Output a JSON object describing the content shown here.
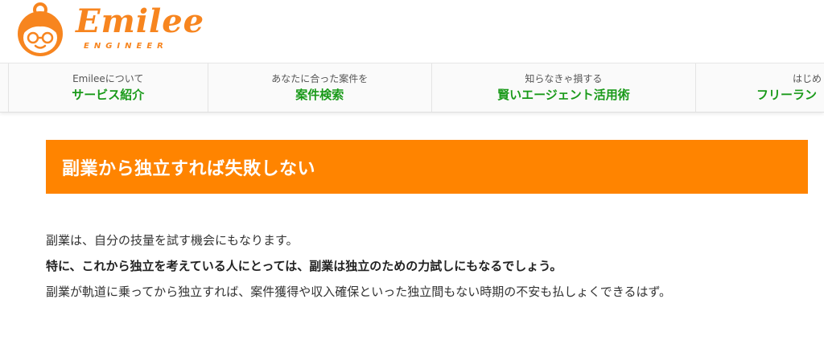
{
  "brand": {
    "name": "Emilee",
    "tagline": "ENGINEER",
    "accent_color": "#f7851f"
  },
  "nav": {
    "items": [
      {
        "sub": "Emileeについて",
        "main": "サービス紹介"
      },
      {
        "sub": "あなたに合った案件を",
        "main": "案件検索"
      },
      {
        "sub": "知らなきゃ損する",
        "main": "賢いエージェント活用術"
      },
      {
        "sub": "はじめ",
        "main": "フリーラン"
      }
    ],
    "main_color": "#1a9a1a"
  },
  "article": {
    "heading": "副業から独立すれば失敗しない",
    "heading_bg": "#ff8400",
    "paragraphs": [
      "副業は、自分の技量を試す機会にもなります。",
      "特に、これから独立を考えている人にとっては、副業は独立のための力試しにもなるでしょう。",
      "副業が軌道に乗ってから独立すれば、案件獲得や収入確保といった独立間もない時期の不安も払しょくできるはず。"
    ]
  }
}
